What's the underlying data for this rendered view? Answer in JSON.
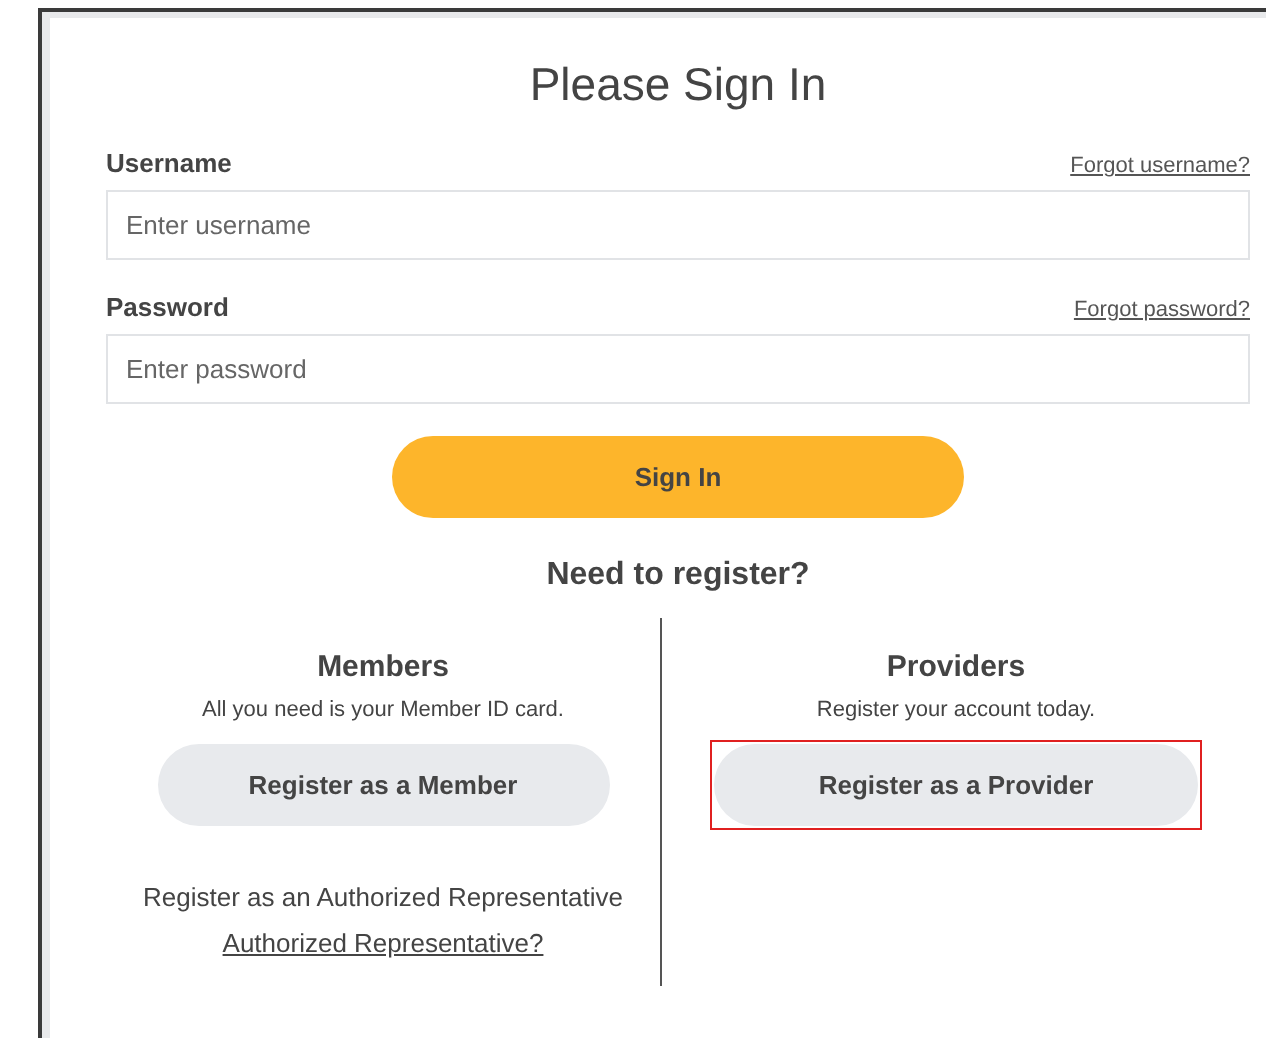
{
  "title": "Please Sign In",
  "fields": [
    {
      "label": "Username",
      "link": "Forgot username?",
      "placeholder": "Enter username"
    },
    {
      "label": "Password",
      "link": "Forgot password?",
      "placeholder": "Enter password"
    }
  ],
  "sign_in_button": "Sign In",
  "register_heading": "Need to register?",
  "sections": [
    {
      "heading": "Members",
      "subtitle": "All you need is your Member ID card.",
      "button": "Register as a Member",
      "highlighted": false,
      "note": "Register as an Authorized Representative",
      "link": "Authorized Representative?"
    },
    {
      "heading": "Providers",
      "subtitle": "Register your account today.",
      "button": "Register as a Provider",
      "highlighted": true
    }
  ]
}
